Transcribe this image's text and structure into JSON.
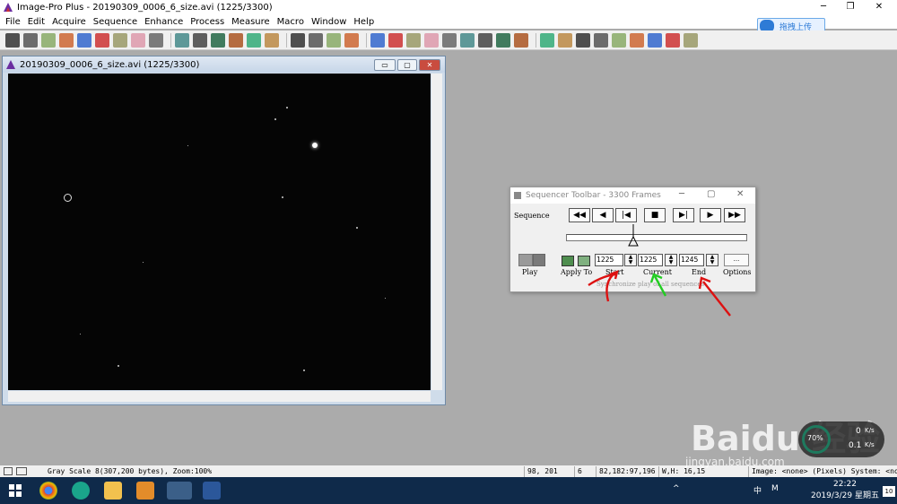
{
  "app": {
    "title": "Image-Pro Plus - 20190309_0006_6_size.avi (1225/3300)",
    "window_controls": [
      "─",
      "❐",
      "✕"
    ]
  },
  "menu": [
    "File",
    "Edit",
    "Acquire",
    "Sequence",
    "Enhance",
    "Process",
    "Measure",
    "Macro",
    "Window",
    "Help"
  ],
  "baidu_button": {
    "label": "拖拽上传"
  },
  "toolbar_icons": [
    "open-icon",
    "save-icon",
    "grid-icon",
    "camera-icon",
    "wand-icon",
    "print-icon",
    "book-icon",
    "mail-icon",
    "undo-icon",
    "new-aoi-icon",
    "rectangle-icon",
    "ellipse-icon",
    "polygon-icon",
    "magic-aoi-icon",
    "pencil-icon",
    "zoom-icon",
    "hand-icon",
    "zoom-fit-icon",
    "measure-icon",
    "histogram-icon",
    "line-profile-icon",
    "bitmap-icon",
    "stack-icon",
    "grid2-icon",
    "cross-icon",
    "colorbar-icon",
    "calibrate-icon",
    "color-icon",
    "count-icon",
    "script-icon",
    "camera2-icon",
    "chart-icon",
    "color2-icon",
    "3d-icon",
    "list-icon",
    "macro-icon",
    "export-icon"
  ],
  "image_window": {
    "title": "20190309_0006_6_size.avi (1225/3300)",
    "buttons": [
      "▭",
      "▢",
      "✕"
    ]
  },
  "sequencer": {
    "title": "Sequencer Toolbar - 3300 Frames",
    "sequence_label": "Sequence",
    "playback_buttons": [
      "◀◀",
      "◀",
      "|◀",
      "■",
      "▶|",
      "▶",
      "▶▶"
    ],
    "play_label": "Play",
    "apply_label": "Apply To",
    "start_label": "Start",
    "current_label": "Current",
    "end_label": "End",
    "options_label": "Options",
    "options_btn": "...",
    "start_value": "1225",
    "current_value": "1225",
    "end_value": "1245",
    "sync_text": "Synchronize play of all sequences",
    "slider_fraction": 0.371
  },
  "status": {
    "info": "Gray Scale 8(307,200 bytes), Zoom:100%",
    "coords": "98, 201",
    "value": "6",
    "rgb": "82,182:97,196",
    "wh": "W,H: 16,15",
    "image": "Image: <none> (Pixels) System: <none>"
  },
  "taskbar": {
    "time": "22:22",
    "date": "2019/3/29 星期五",
    "tray": [
      "^",
      "中",
      "M"
    ],
    "badge": "10"
  },
  "net_widget": {
    "percent": "70%",
    "up": "0",
    "up_unit": "K/s",
    "down": "0.1",
    "down_unit": "K/s"
  },
  "watermark": {
    "main": "Baidu 经验",
    "sub": "jingyan.baidu.com"
  }
}
